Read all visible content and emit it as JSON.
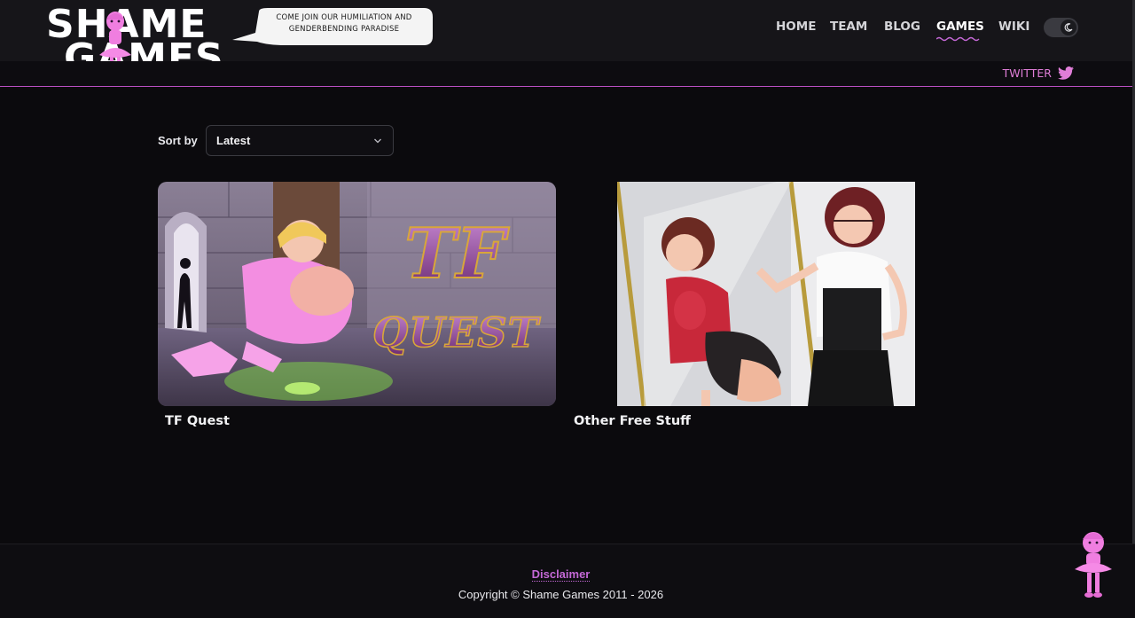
{
  "header": {
    "logo_line1": "SHAME",
    "logo_line2": "GAMES",
    "tagline": "Come join our humiliation and genderbending paradise",
    "nav": [
      {
        "label": "HOME"
      },
      {
        "label": "TEAM"
      },
      {
        "label": "BLOG"
      },
      {
        "label": "GAMES",
        "active": true
      },
      {
        "label": "WIKI"
      }
    ],
    "theme_toggle": "dark-mode-moon-icon"
  },
  "subbar": {
    "twitter_label": "TWITTER"
  },
  "sort": {
    "label": "Sort by",
    "selected": "Latest"
  },
  "games": [
    {
      "title": "TF Quest",
      "art_title": "TF QUEST"
    },
    {
      "title": "Other Free Stuff"
    }
  ],
  "footer": {
    "disclaimer": "Disclaimer",
    "copyright": "Copyright © Shame Games 2011 - 2026"
  },
  "colors": {
    "accent": "#c468d6",
    "twitter": "#e07ed8",
    "background": "#0b0a0d",
    "header": "#161519"
  }
}
